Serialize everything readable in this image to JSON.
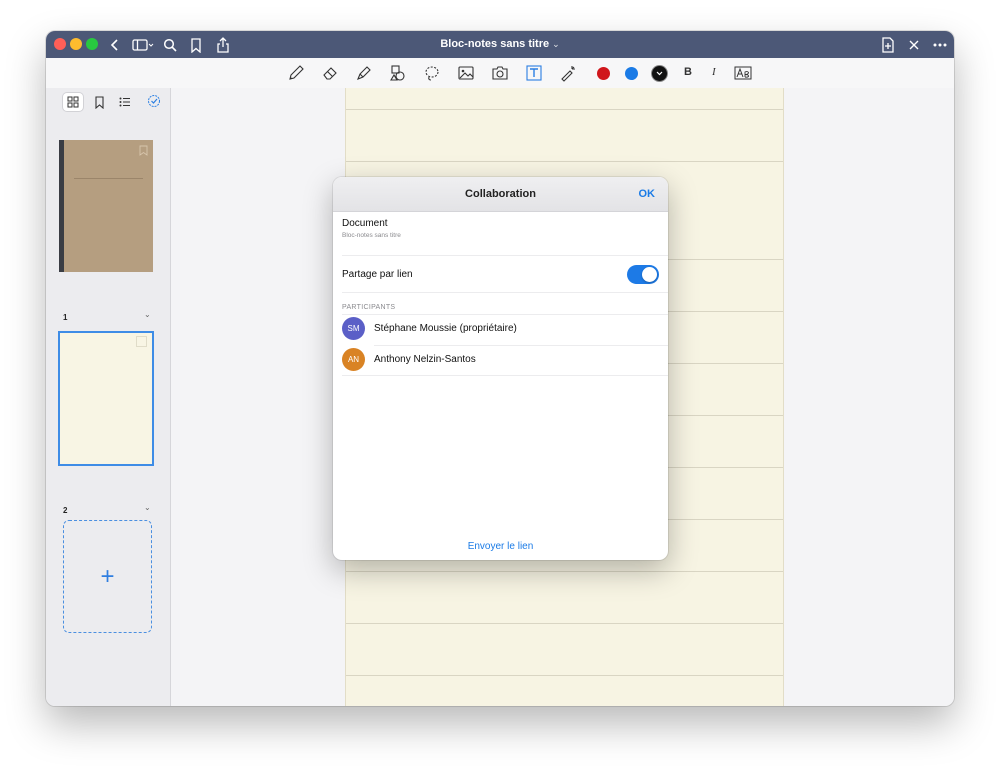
{
  "window": {
    "title": "Bloc-notes sans titre"
  },
  "toolbar": {
    "colors": [
      "#d0161b",
      "#1b7be6",
      "#111111"
    ],
    "bold_label": "B",
    "italic_label": "I"
  },
  "sidebar": {
    "pages": [
      {
        "number": "1"
      },
      {
        "number": "2"
      }
    ],
    "add_page_label": "+"
  },
  "dialog": {
    "title": "Collaboration",
    "ok_label": "OK",
    "document_label": "Document",
    "document_name": "Bloc-notes sans titre",
    "link_sharing_label": "Partage par lien",
    "link_sharing_on": true,
    "participants_header": "PARTICIPANTS",
    "participants": [
      {
        "initials": "SM",
        "name": "Stéphane Moussie (propriétaire)",
        "color": "#5b5fc7"
      },
      {
        "initials": "AN",
        "name": "Anthony Nelzin-Santos",
        "color": "#d98324"
      }
    ],
    "send_link_label": "Envoyer le lien"
  }
}
